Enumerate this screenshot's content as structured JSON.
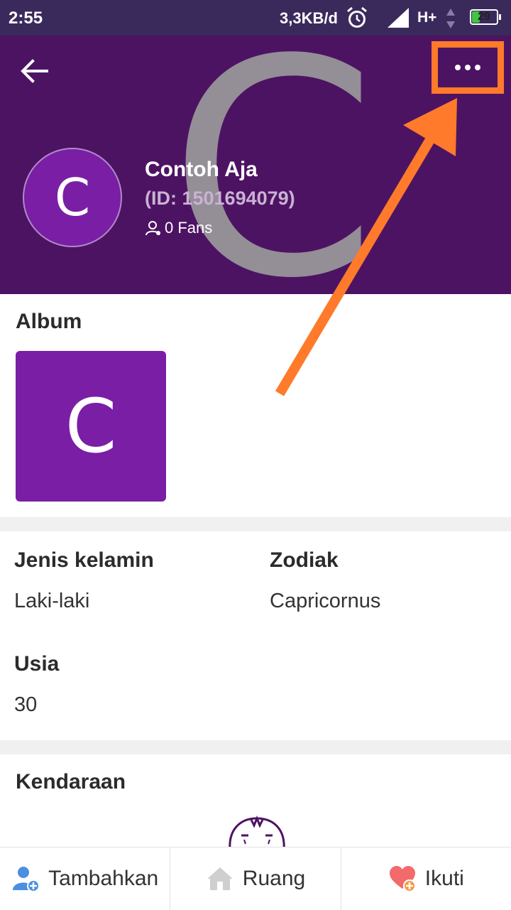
{
  "status_bar": {
    "time": "2:55",
    "network_speed": "3,3KB/d",
    "network_type": "H+",
    "battery_level": "29"
  },
  "profile": {
    "name": "Contoh Aja",
    "id_text": "(ID: 1501694079)",
    "fans_text": "0 Fans",
    "avatar_letter": "C"
  },
  "album": {
    "title": "Album",
    "thumb_letter": "C"
  },
  "info": {
    "gender_label": "Jenis kelamin",
    "gender_value": "Laki-laki",
    "zodiac_label": "Zodiak",
    "zodiac_value": "Capricornus",
    "age_label": "Usia",
    "age_value": "30"
  },
  "vehicle": {
    "title": "Kendaraan"
  },
  "bottom_bar": {
    "add_label": "Tambahkan",
    "room_label": "Ruang",
    "follow_label": "Ikuti"
  },
  "colors": {
    "header_bg": "#4d1363",
    "avatar_bg": "#7a1ea6",
    "highlight": "#ff7a2a"
  },
  "icons": [
    "back-arrow-icon",
    "more-dots-icon",
    "fans-user-icon",
    "add-friend-icon",
    "home-icon",
    "heart-plus-icon",
    "alarm-icon",
    "signal-icon",
    "battery-icon"
  ]
}
